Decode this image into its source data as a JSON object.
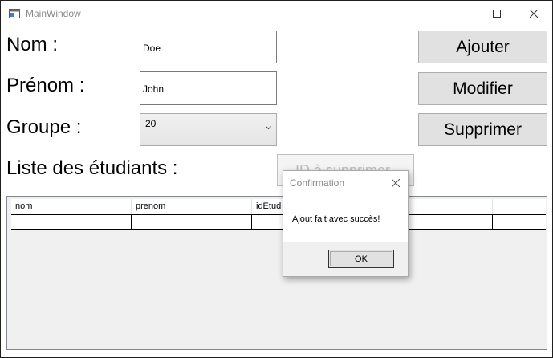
{
  "window": {
    "title": "MainWindow"
  },
  "form": {
    "nom_label": "Nom :",
    "nom_value": "Doe",
    "prenom_label": "Prénom :",
    "prenom_value": "John",
    "groupe_label": "Groupe :",
    "groupe_value": "20",
    "liste_label": "Liste des étudiants :"
  },
  "buttons": {
    "ajouter": "Ajouter",
    "modifier": "Modifier",
    "supprimer": "Supprimer",
    "id_supprimer": "ID à supprimer"
  },
  "grid": {
    "columns": [
      "nom",
      "prenom",
      "idEtud"
    ]
  },
  "dialog": {
    "title": "Confirmation",
    "message": "Ajout fait avec succès!",
    "ok": "OK"
  },
  "icons": {
    "app": "window-icon",
    "minimize": "minimize-icon",
    "maximize": "maximize-icon",
    "close": "close-icon",
    "dropdown": "chevron-down-icon"
  }
}
